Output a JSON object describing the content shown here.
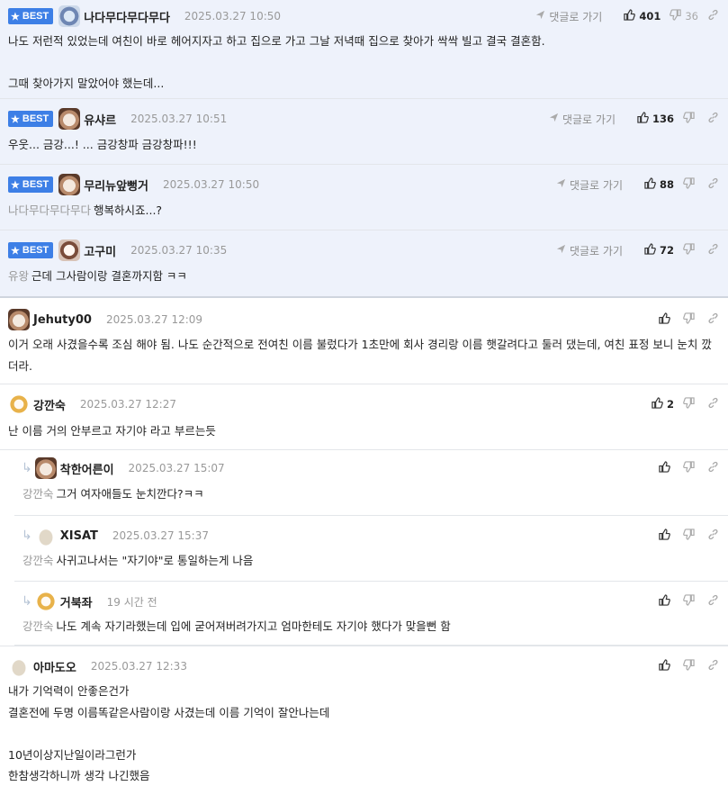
{
  "labels": {
    "best": "BEST",
    "reply_to": "댓글로 가기"
  },
  "comments": [
    {
      "best": true,
      "nick": "나다무다무다무다",
      "date": "2025.03.27 10:50",
      "body": "나도 저런적 있었는데 여친이 바로 헤어지자고 하고 집으로 가고 그날 저녁때 집으로 찾아가 싹싹 빌고 결국 결혼함.\n\n그때 찾아가지 말았어야 했는데...",
      "like_count": "401",
      "dislike_count": "36"
    },
    {
      "best": true,
      "nick": "유샤르",
      "date": "2025.03.27 10:51",
      "body": "우웃... 금강...! ... 금강창파 금강창파!!!",
      "like_count": "136"
    },
    {
      "best": true,
      "nick": "무리뉴앞뻥거",
      "date": "2025.03.27 10:50",
      "mention": "나다무다무다무다",
      "body": "행복하시죠...?",
      "like_count": "88"
    },
    {
      "best": true,
      "nick": "고구미",
      "date": "2025.03.27 10:35",
      "mention": "유왕",
      "body": "근데 그사람이랑 결혼까지함 ㅋㅋ",
      "like_count": "72"
    },
    {
      "nick": "Jehuty00",
      "date": "2025.03.27 12:09",
      "body": "이거 오래 사겼을수록 조심 해야 됨. 나도 순간적으로 전여친 이름 불렀다가 1초만에 회사 경리랑 이름 햇갈려다고 둘러 댔는데, 여친 표정 보니 눈치 깠더라."
    },
    {
      "nick": "강깐숙",
      "date": "2025.03.27 12:27",
      "body": "난 이름 거의 안부르고 자기야 라고 부르는듯",
      "like_count": "2"
    },
    {
      "reply": true,
      "nick": "착한어른이",
      "date": "2025.03.27 15:07",
      "mention": "강깐숙",
      "body": "그거 여자애들도 눈치깐다?ㅋㅋ"
    },
    {
      "reply": true,
      "nick": "XISAT",
      "date": "2025.03.27 15:37",
      "mention": "강깐숙",
      "body": "사귀고나서는 \"자기야\"로 통일하는게 나음"
    },
    {
      "reply": true,
      "nick": "거북좌",
      "date": "19 시간 전",
      "mention": "강깐숙",
      "body": "나도 계속 자기라했는데 입에 굳어져버려가지고 엄마한테도 자기야 했다가 맞을뻔 함"
    },
    {
      "nick": "아마도오",
      "date": "2025.03.27 12:33",
      "body": "내가 기억력이 안좋은건가\n결혼전에 두명 이름똑같은사람이랑 사겼는데 이름 기억이 잘안나는데\n\n10년이상지난일이라그런가\n한참생각하니까 생각 나긴했음"
    }
  ]
}
